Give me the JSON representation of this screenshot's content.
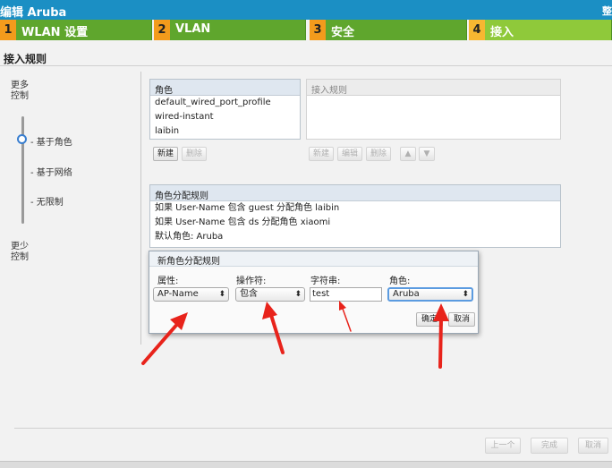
{
  "window": {
    "title": "编辑 Aruba",
    "right_text": "整"
  },
  "steps": [
    {
      "num": "1",
      "label": "WLAN 设置"
    },
    {
      "num": "2",
      "label": "VLAN"
    },
    {
      "num": "3",
      "label": "安全"
    },
    {
      "num": "4",
      "label": "接入"
    }
  ],
  "section_title": "接入规则",
  "sidebar": {
    "more": [
      "更多",
      "控制"
    ],
    "less": [
      "更少",
      "控制"
    ],
    "options": [
      {
        "label": "- 基于角色",
        "selected": true
      },
      {
        "label": "- 基于网络",
        "selected": false
      },
      {
        "label": "- 无限制",
        "selected": false
      }
    ]
  },
  "roles_panel": {
    "header": "角色",
    "items": [
      "default_wired_port_profile",
      "wired-instant",
      "laibin"
    ],
    "new_button": "新建",
    "delete_button": "删除"
  },
  "rules_panel": {
    "header": "接入规则",
    "buttons": [
      "新建",
      "编辑",
      "删除"
    ],
    "up_icon": "arrow-up-icon",
    "down_icon": "arrow-down-icon"
  },
  "assignment_panel": {
    "header": "角色分配规则",
    "rules": [
      "如果 User-Name 包含 guest 分配角色 laibin",
      "如果 User-Name 包含 ds 分配角色 xiaomi",
      "默认角色: Aruba"
    ]
  },
  "dialog": {
    "title": "新角色分配规则",
    "labels": {
      "attribute": "属性:",
      "operator": "操作符:",
      "string": "字符串:",
      "role": "角色:"
    },
    "values": {
      "attribute": "AP-Name",
      "operator": "包含",
      "string": "test",
      "role": "Aruba"
    },
    "ok_button": "确定",
    "cancel_button": "取消"
  },
  "footer": {
    "prev": "上一个",
    "finish": "完成",
    "cancel": "取消"
  },
  "annotation_color": "#e8231b"
}
